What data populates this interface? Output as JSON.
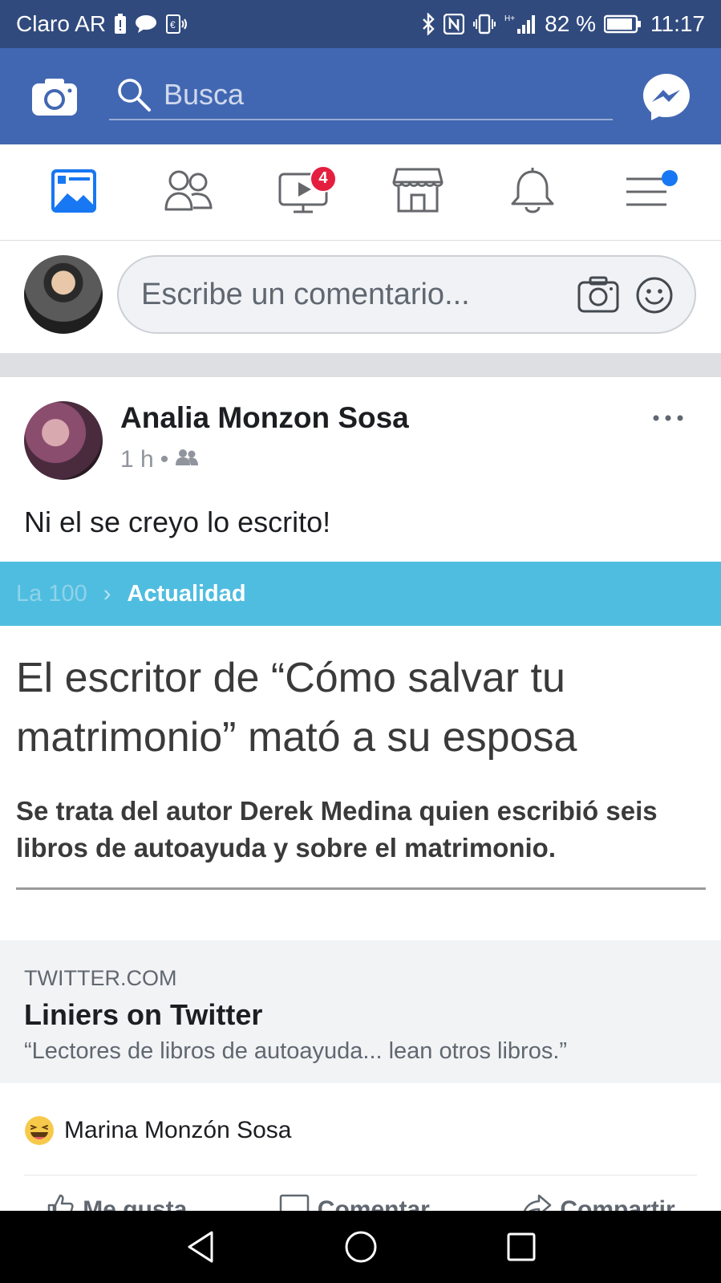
{
  "status_bar": {
    "carrier": "Claro AR",
    "battery_percent": "82 %",
    "time": "11:17"
  },
  "header": {
    "search_placeholder": "Busca",
    "icons": [
      "camera-icon",
      "search-icon",
      "messenger-icon"
    ]
  },
  "nav_tabs": [
    {
      "name": "news-feed",
      "icon": "news-feed-icon",
      "active": true
    },
    {
      "name": "friends",
      "icon": "friends-icon"
    },
    {
      "name": "watch",
      "icon": "watch-icon",
      "badge": "4"
    },
    {
      "name": "marketplace",
      "icon": "marketplace-icon"
    },
    {
      "name": "notifications",
      "icon": "bell-icon"
    },
    {
      "name": "menu",
      "icon": "menu-icon",
      "has_dot": true
    }
  ],
  "composer": {
    "placeholder": "Escribe un comentario..."
  },
  "post": {
    "author": "Analia Monzon Sosa",
    "time": "1 h",
    "text": "Ni el se creyo lo escrito!",
    "shared_image": {
      "breadcrumb_1": "La 100",
      "breadcrumb_2": "Actualidad",
      "headline": "El escritor de “Cómo salvar tu matrimonio” mató a su esposa",
      "subheadline": "Se trata del autor Derek Medina quien escribió seis libros de autoayuda y sobre el matrimonio."
    },
    "link_card": {
      "domain": "TWITTER.COM",
      "title": "Liniers on Twitter",
      "description": "“Lectores de libros de autoayuda... lean otros libros.”"
    },
    "reaction": {
      "icon": "haha-emoji-icon",
      "name": "Marina Monzón Sosa"
    },
    "actions": [
      {
        "label": "Me gusta",
        "icon": "like-icon"
      },
      {
        "label": "Comentar",
        "icon": "comment-icon"
      },
      {
        "label": "Compartir",
        "icon": "share-icon"
      }
    ]
  },
  "colors": {
    "status_bar": "#314a7e",
    "header": "#4267b2",
    "accent": "#1877f2",
    "badge": "#e41e3f",
    "article_bar": "#4fbde0"
  }
}
